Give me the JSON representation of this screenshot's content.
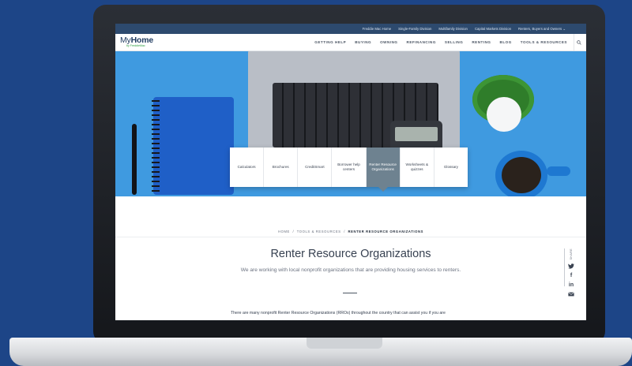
{
  "utility_links": [
    "Freddie Mac Home",
    "Single-Family Division",
    "Multifamily Division",
    "Capital Markets Division",
    "Renters, Buyers and Owners ⌄"
  ],
  "logo": {
    "my": "My",
    "home": "Home",
    "by": "by FreddieMac"
  },
  "nav_items": [
    "GETTING HELP",
    "BUYING",
    "OWNING",
    "REFINANCING",
    "SELLING",
    "RENTING",
    "BLOG",
    "TOOLS & RESOURCES"
  ],
  "tiles": [
    {
      "label": "Calculators",
      "active": false
    },
    {
      "label": "Brochures",
      "active": false
    },
    {
      "label": "CreditSmart",
      "active": false
    },
    {
      "label": "Borrower help centers",
      "active": false
    },
    {
      "label": "Renter Resource Organizations",
      "active": true
    },
    {
      "label": "Worksheets & quizzes",
      "active": false
    },
    {
      "label": "Glossary",
      "active": false
    }
  ],
  "breadcrumb": {
    "home": "HOME",
    "sep": "/",
    "section": "TOOLS & RESOURCES",
    "current": "RENTER RESOURCE ORGANIZATIONS"
  },
  "page_title": "Renter Resource Organizations",
  "subtitle": "We are working with local nonprofit organizations that are providing housing services to renters.",
  "body_text": "There are many nonprofit Renter Resource Organizations (RROs) throughout the country that can assist you if you are",
  "share": {
    "label": "SHARE",
    "icons": [
      "twitter-icon",
      "facebook-icon",
      "linkedin-icon",
      "email-icon"
    ]
  },
  "colors": {
    "background": "#1d4587",
    "utility_bar": "#2d4a6e",
    "active_tile": "#6e8290",
    "hero_blue": "#3f9ae0"
  }
}
